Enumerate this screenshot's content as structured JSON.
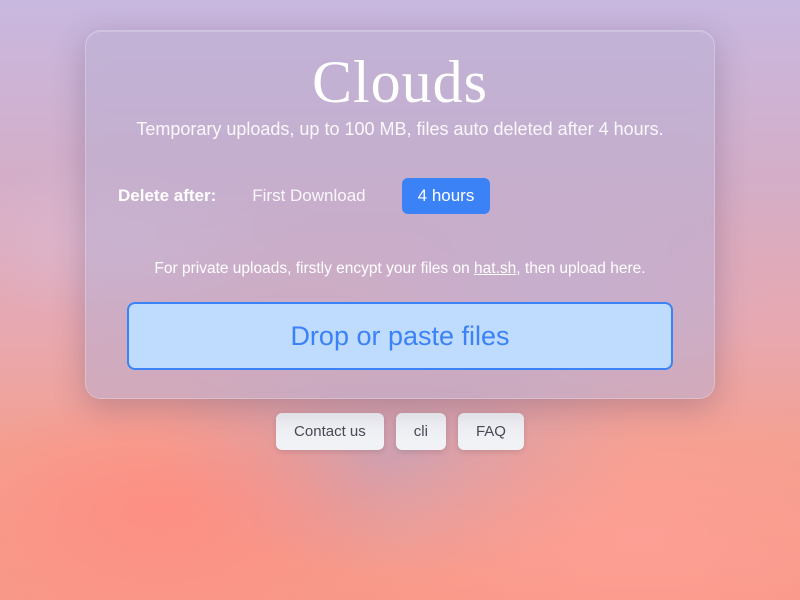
{
  "app": {
    "title": "Clouds",
    "subtitle": "Temporary uploads, up to 100 MB, files auto deleted after 4 hours."
  },
  "delete_after": {
    "label": "Delete after:",
    "options": [
      {
        "label": "First Download",
        "selected": false
      },
      {
        "label": "4 hours",
        "selected": true
      }
    ]
  },
  "encrypt_note": {
    "prefix": "For private uploads, firstly encypt your files on ",
    "link_text": "hat.sh",
    "suffix": ", then upload here."
  },
  "dropzone": {
    "label": "Drop or paste files"
  },
  "footer": {
    "contact": "Contact us",
    "cli": "cli",
    "faq": "FAQ"
  }
}
